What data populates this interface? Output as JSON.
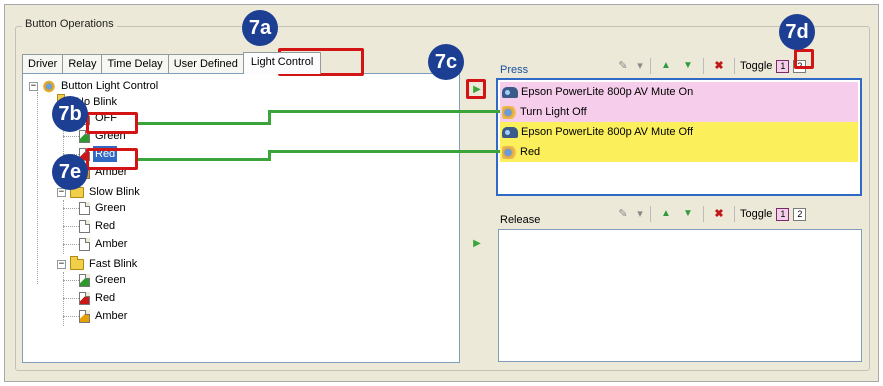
{
  "group_title": "Button Operations",
  "tabs": [
    "Driver",
    "Relay",
    "Time Delay",
    "User Defined",
    "Light Control"
  ],
  "active_tab": "Light Control",
  "tree": {
    "root": "Button Light Control",
    "groups": [
      {
        "label": "No Blink",
        "items": [
          "OFF",
          "Green",
          "Red",
          "Amber"
        ]
      },
      {
        "label": "Slow Blink",
        "items": [
          "Green",
          "Red",
          "Amber"
        ]
      },
      {
        "label": "Fast Blink",
        "items": [
          "Green",
          "Red",
          "Amber"
        ]
      }
    ],
    "selected": "Red"
  },
  "press": {
    "label": "Press",
    "toggle_label": "Toggle",
    "toggle_buttons": [
      "1",
      "2"
    ],
    "rows": [
      {
        "icon": "projector-icon",
        "text": "Epson PowerLite 800p AV Mute On",
        "color": "#f6cdea"
      },
      {
        "icon": "light-icon",
        "text": "Turn Light Off",
        "color": "#f6cdea"
      },
      {
        "icon": "projector-icon",
        "text": "Epson PowerLite 800p AV Mute Off",
        "color": "#fbef5c"
      },
      {
        "icon": "light-icon",
        "text": "Red",
        "color": "#fbef5c"
      }
    ]
  },
  "release": {
    "label": "Release",
    "toggle_label": "Toggle",
    "toggle_buttons": [
      "1",
      "2"
    ]
  },
  "callouts": {
    "c7a": "7a",
    "c7b": "7b",
    "c7c": "7c",
    "c7d": "7d",
    "c7e": "7e"
  },
  "colors": {
    "callout": "#1c3f93",
    "highlight": "#d21414",
    "connector": "#3aa43a",
    "selection": "#316ac5"
  }
}
